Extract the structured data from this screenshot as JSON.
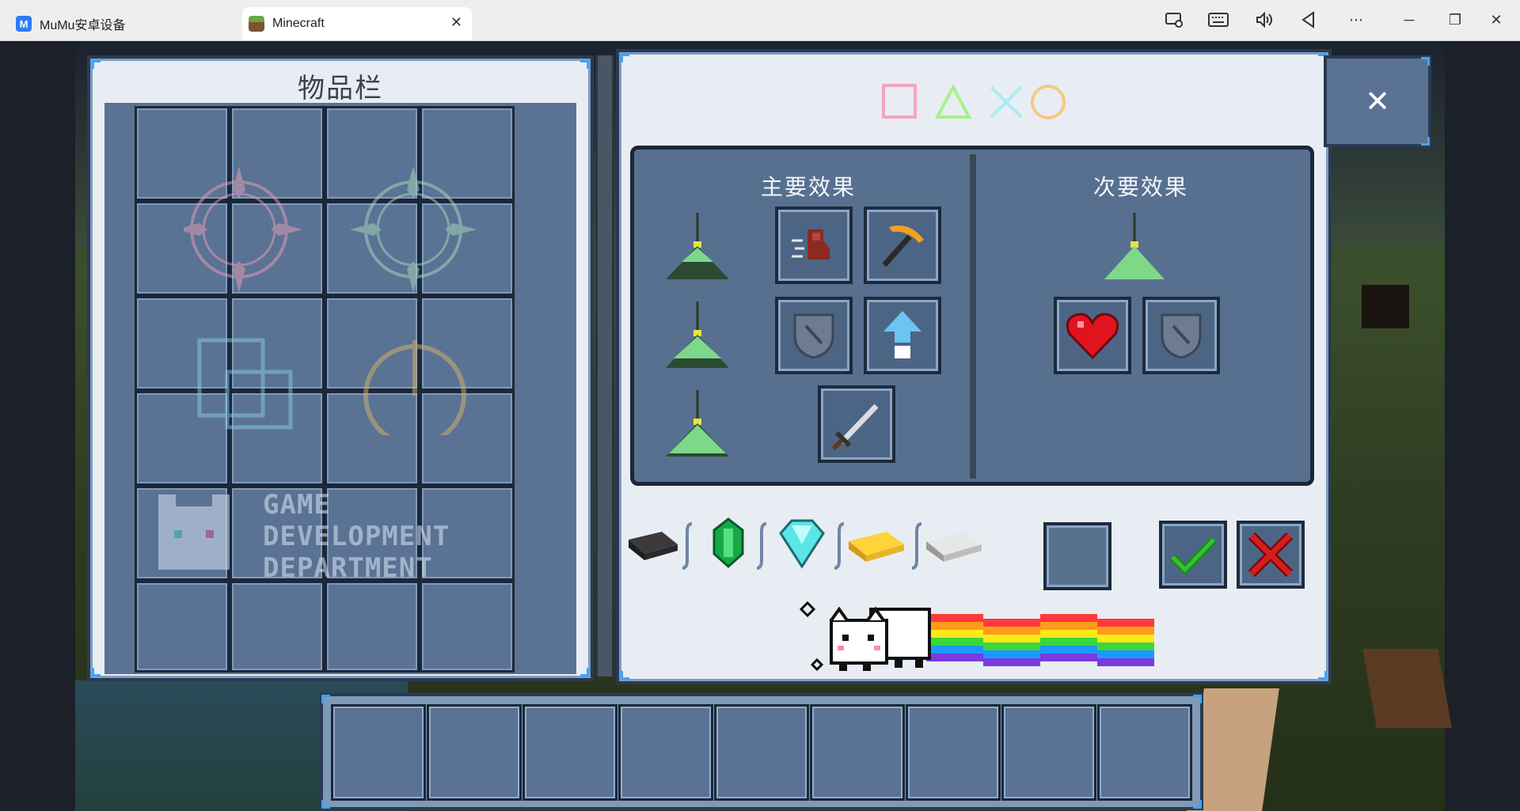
{
  "window": {
    "tabs": [
      {
        "label": "MuMu安卓设备",
        "icon": "mumu-logo-icon"
      },
      {
        "label": "Minecraft",
        "icon": "minecraft-grass-block-icon"
      }
    ],
    "toolbar_icons": [
      "screen-record-icon",
      "keyboard-icon",
      "volume-icon",
      "back-icon",
      "more-icon",
      "minimize-icon",
      "restore-icon",
      "close-icon"
    ]
  },
  "inventory": {
    "title": "物品栏",
    "watermark_lines": [
      "GAME",
      "DEVELOPMENT",
      "DEPARTMENT"
    ]
  },
  "beacon": {
    "primary_title": "主要效果",
    "secondary_title": "次要效果",
    "primary_effects": [
      "speed-icon",
      "haste-icon",
      "resistance-icon",
      "jump-boost-icon",
      "strength-icon"
    ],
    "secondary_effects": [
      "regeneration-icon",
      "resistance-icon"
    ],
    "payment_items": [
      "netherite-ingot-icon",
      "emerald-icon",
      "diamond-icon",
      "gold-ingot-icon",
      "iron-ingot-icon"
    ],
    "controls": {
      "confirm": "confirm-check-icon",
      "cancel": "cancel-x-icon"
    }
  },
  "close_button": "✕",
  "colors": {
    "panel_bg": "#e8edf3",
    "slot_bg": "#5a7293",
    "accent": "#3ea4ff",
    "confirm": "#2fb32f",
    "cancel": "#c81e1e"
  }
}
